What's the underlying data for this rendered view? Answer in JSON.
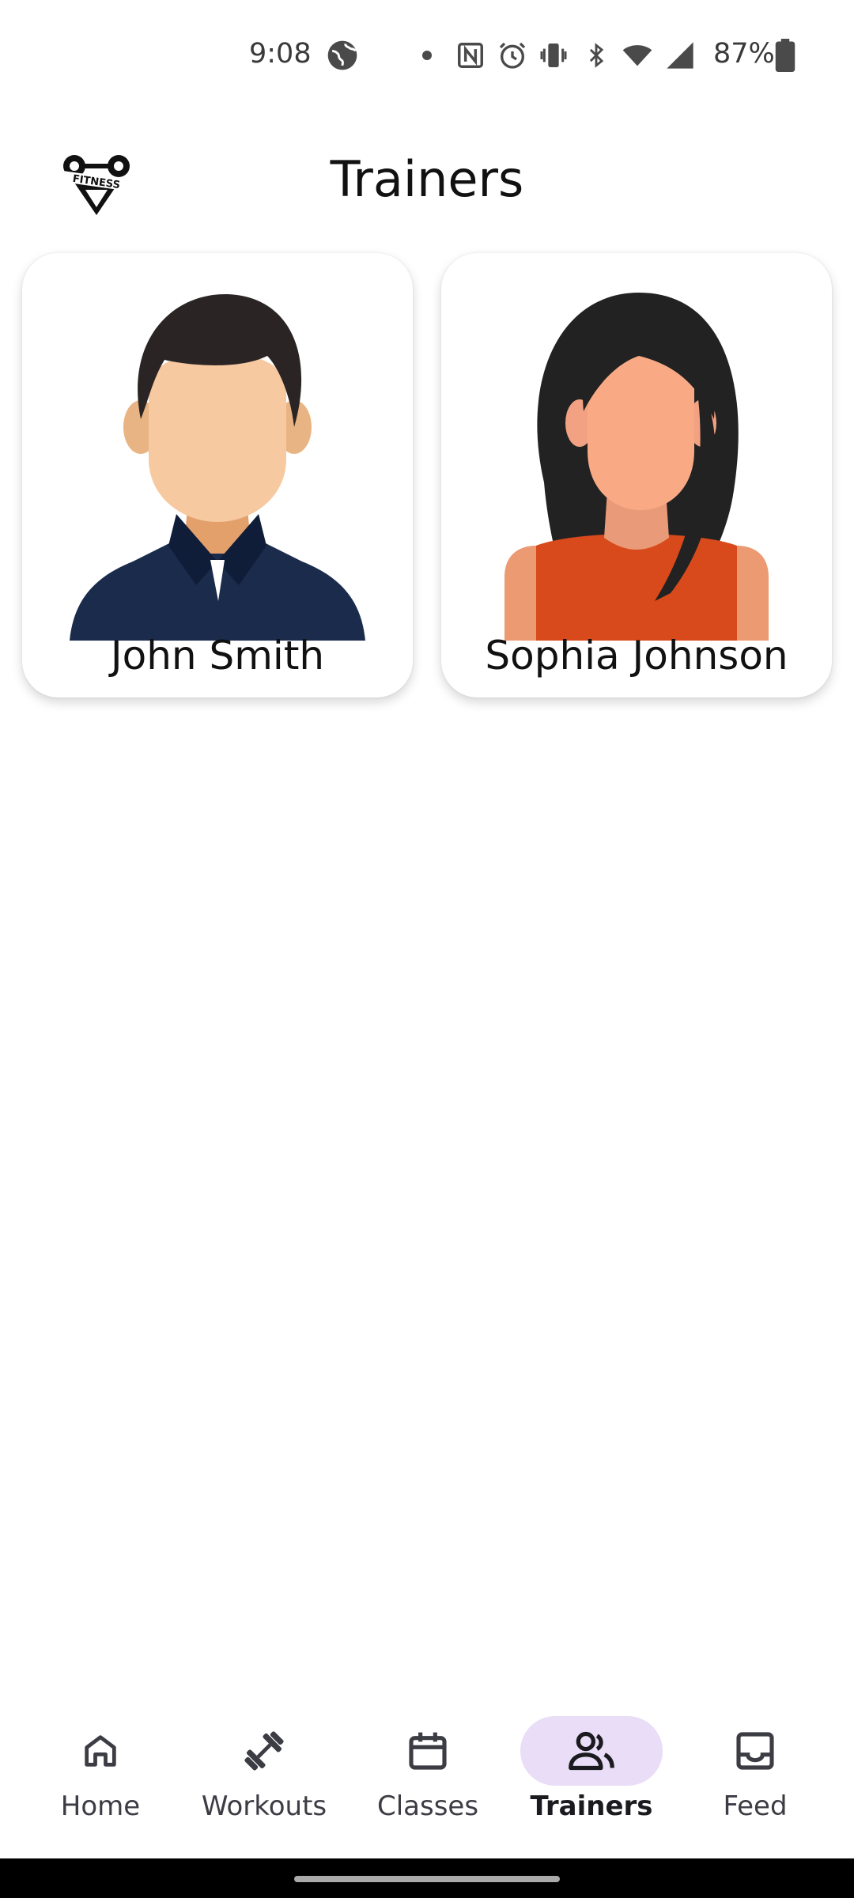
{
  "status_bar": {
    "time": "9:08",
    "battery": "87%",
    "icons": [
      "globe-icon",
      "dot-icon",
      "nfc-icon",
      "alarm-icon",
      "vibrate-icon",
      "bluetooth-icon",
      "wifi-icon",
      "signal-icon",
      "battery-icon"
    ]
  },
  "header": {
    "title": "Trainers",
    "logo_text": "FITNESS"
  },
  "trainers": [
    {
      "name": "John Smith",
      "avatar": "male-avatar"
    },
    {
      "name": "Sophia Johnson",
      "avatar": "female-avatar"
    }
  ],
  "bottom_nav": {
    "items": [
      {
        "label": "Home",
        "icon": "home-icon",
        "active": false
      },
      {
        "label": "Workouts",
        "icon": "dumbbell-icon",
        "active": false
      },
      {
        "label": "Classes",
        "icon": "calendar-icon",
        "active": false
      },
      {
        "label": "Trainers",
        "icon": "people-icon",
        "active": true
      },
      {
        "label": "Feed",
        "icon": "inbox-icon",
        "active": false
      }
    ]
  },
  "colors": {
    "active_pill": "#e9ddf7",
    "male_shirt": "#1a2b4c",
    "female_top": "#d84a1b",
    "skin": "#f6c9a0",
    "hair": "#2a2424"
  }
}
